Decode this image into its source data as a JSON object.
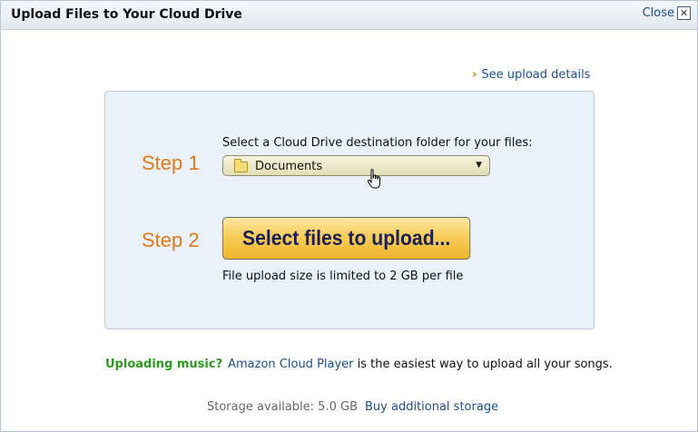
{
  "dialog": {
    "title": "Upload Files to Your Cloud Drive",
    "close_label": "Close",
    "close_glyph": "✕"
  },
  "details_link": {
    "chevron": "›",
    "label": "See upload details"
  },
  "step1": {
    "label": "Step 1",
    "instruction": "Select a Cloud Drive destination folder for your files:",
    "folder_value": "Documents",
    "dropdown_glyph": "▼"
  },
  "step2": {
    "label": "Step 2",
    "button_label": "Select files to upload...",
    "size_note": "File upload size is limited to 2 GB per file"
  },
  "music": {
    "label": "Uploading music?",
    "link": "Amazon Cloud Player",
    "text": " is the easiest way to upload all your songs."
  },
  "storage": {
    "text": "Storage available: 5.0 GB",
    "buy_link": "Buy additional storage"
  },
  "icons": {
    "folder": "folder-icon",
    "close": "close-icon",
    "cursor": "hand-pointer-icon"
  },
  "colors": {
    "step_orange": "#e47911",
    "link_blue": "#1b4f8a",
    "music_green": "#2c9a1e",
    "panel_bg": "#eaf1fa",
    "button_gold": "#f7cd59"
  }
}
